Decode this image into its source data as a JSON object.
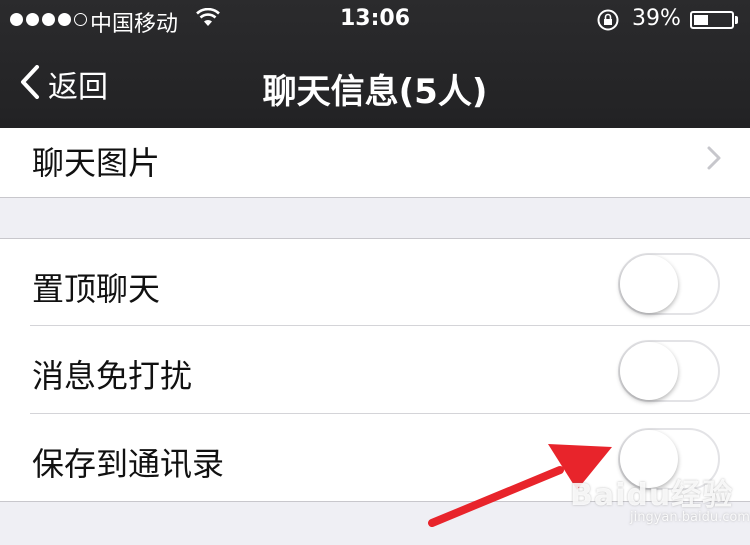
{
  "status_bar": {
    "carrier": "中国移动",
    "time": "13:06",
    "battery": "39%",
    "battery_level": 0.39
  },
  "nav": {
    "back_label": "返回",
    "title": "聊天信息(5人)"
  },
  "rows": {
    "photos": {
      "label": "聊天图片"
    },
    "pin": {
      "label": "置顶聊天",
      "on": false
    },
    "mute": {
      "label": "消息免打扰",
      "on": false
    },
    "save": {
      "label": "保存到通讯录",
      "on": false
    }
  },
  "watermark": {
    "main": "Baidu经验",
    "sub": "jingyan.baidu.com"
  },
  "colors": {
    "nav_background": "#232325",
    "page_background": "#efeff4",
    "annotation_arrow": "#e8242b"
  }
}
